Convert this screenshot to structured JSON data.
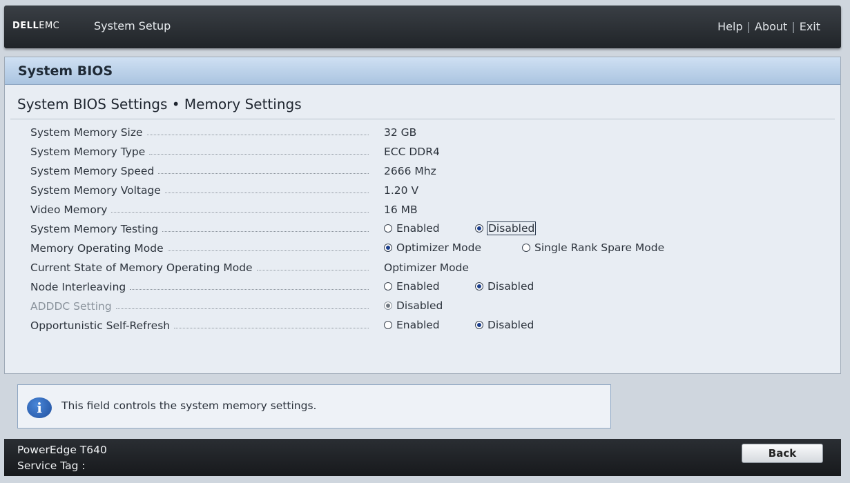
{
  "header": {
    "brand_a": "DELL",
    "brand_b": "EMC",
    "app_title": "System Setup",
    "links": [
      "Help",
      "About",
      "Exit"
    ],
    "separator": "|"
  },
  "panel": {
    "title": "System BIOS",
    "page_title": "System BIOS Settings • Memory Settings"
  },
  "settings": [
    {
      "label": "System Memory Size",
      "value": "32 GB"
    },
    {
      "label": "System Memory Type",
      "value": "ECC DDR4"
    },
    {
      "label": "System Memory Speed",
      "value": "2666 Mhz"
    },
    {
      "label": "System Memory Voltage",
      "value": "1.20 V"
    },
    {
      "label": "Video Memory",
      "value": "16 MB"
    },
    {
      "label": "System Memory Testing",
      "options": [
        "Enabled",
        "Disabled"
      ],
      "selected": "Disabled",
      "focused": true
    },
    {
      "label": "Memory Operating Mode",
      "options": [
        "Optimizer Mode",
        "Single Rank Spare Mode"
      ],
      "selected": "Optimizer Mode"
    },
    {
      "label": "Current State of Memory Operating Mode",
      "value": "Optimizer Mode"
    },
    {
      "label": "Node Interleaving",
      "options": [
        "Enabled",
        "Disabled"
      ],
      "selected": "Disabled"
    },
    {
      "label": "ADDDC Setting",
      "options": [
        "Disabled"
      ],
      "selected": "Disabled",
      "disabled": true
    },
    {
      "label": "Opportunistic Self-Refresh",
      "options": [
        "Enabled",
        "Disabled"
      ],
      "selected": "Disabled"
    }
  ],
  "help": {
    "icon": "info-icon",
    "text": "This field controls the system memory settings."
  },
  "footer": {
    "model": "PowerEdge T640",
    "service_tag_label": "Service Tag :",
    "back_label": "Back"
  },
  "colors": {
    "panel_header": "#aac4e0",
    "radio_selected": "#1a3e8c",
    "topbar": "#202428"
  }
}
